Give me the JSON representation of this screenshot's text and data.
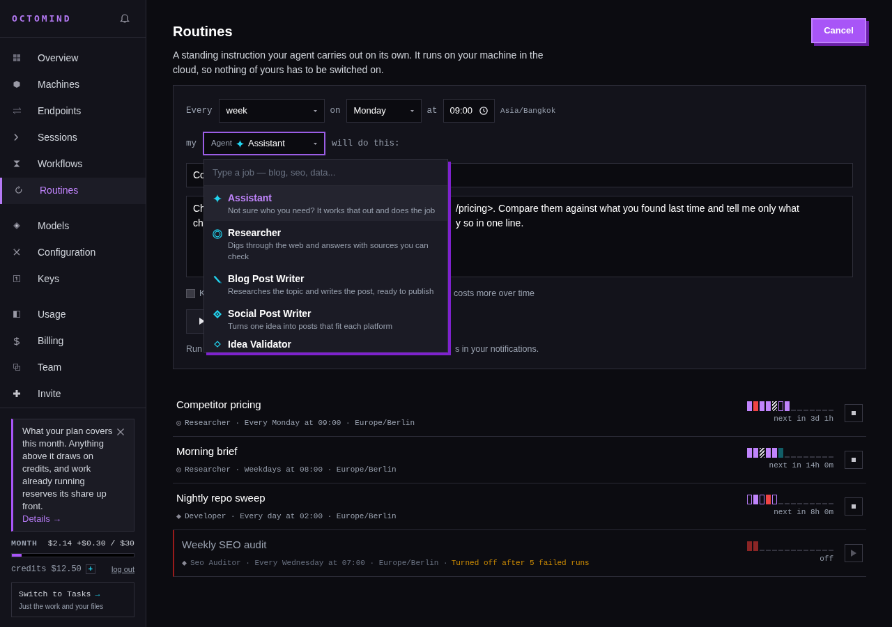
{
  "sidebar": {
    "logo": "OCTOMIND",
    "nav_groups": [
      [
        {
          "label": "Overview",
          "selected": false
        },
        {
          "label": "Machines",
          "selected": false
        },
        {
          "label": "Endpoints",
          "selected": false
        },
        {
          "label": "Sessions",
          "selected": false
        },
        {
          "label": "Workflows",
          "selected": false
        },
        {
          "label": "Routines",
          "selected": true
        }
      ],
      [
        {
          "label": "Models",
          "selected": false
        },
        {
          "label": "Configuration",
          "selected": false
        },
        {
          "label": "Keys",
          "selected": false
        }
      ],
      [
        {
          "label": "Usage",
          "selected": false
        },
        {
          "label": "Billing",
          "selected": false
        },
        {
          "label": "Team",
          "selected": false
        },
        {
          "label": "Invite",
          "selected": false
        }
      ]
    ],
    "notice": {
      "text": "What your plan covers this month. Anything above it draws on credits, and work already running reserves its share up front.",
      "link": "Details →"
    },
    "budget": {
      "label": "MONTH",
      "amount": "$2.14 +$0.30 / $30",
      "level": 0.08
    },
    "credits": "credits $12.50",
    "add_credits": "+",
    "logout": "log out",
    "switch": {
      "title": "Switch to Tasks",
      "arrow": "→",
      "subtitle": "Just the work and your files"
    }
  },
  "page": {
    "title": "Routines",
    "description": "A standing instruction your agent carries out on its own. It runs on your machine in the cloud, so nothing of yours has to be switched on.",
    "cancel": "Cancel"
  },
  "form": {
    "every_label": "Every",
    "frequency": "week",
    "on_label": "on",
    "day": "Monday",
    "at_label": "at",
    "time": "09:00",
    "timezone": "Asia/Bangkok",
    "my_label": "my",
    "agent_prefix": "Agent",
    "agent": "Assistant",
    "suffix": "will do this:",
    "title_field": {
      "left": "Co"
    },
    "prompt_lines": [
      {
        "left": "Ch",
        "right": "/pricing>. Compare them against what you found last time and tell me only what"
      },
      {
        "left": "ch",
        "right": "y so in one line."
      }
    ],
    "checkbox": {
      "checked": false,
      "left": "K",
      "right": "costs more over time"
    },
    "note": {
      "left": "Run",
      "right": "s in your notifications."
    }
  },
  "agent_menu": {
    "placeholder": "Type a job — blog, seo, data...",
    "items": [
      {
        "name": "Assistant",
        "description": "Not sure who you need? It works that out and does the job",
        "selected": true
      },
      {
        "name": "Researcher",
        "description": "Digs through the web and answers with sources you can check",
        "selected": false
      },
      {
        "name": "Blog Post Writer",
        "description": "Researches the topic and writes the post, ready to publish",
        "selected": false
      },
      {
        "name": "Social Post Writer",
        "description": "Turns one idea into posts that fit each platform",
        "selected": false
      },
      {
        "name": "Idea Validator",
        "selected": false
      }
    ]
  },
  "routines": [
    {
      "name": "Competitor pricing",
      "meta": "Researcher · Every Monday at 09:00 · Europe/Berlin",
      "enabled": true,
      "runs": [
        {
          "kind": "ok"
        },
        {
          "kind": "failed"
        },
        {
          "kind": "ok"
        },
        {
          "kind": "ok"
        },
        {
          "kind": "running"
        },
        {
          "kind": "queued"
        },
        {
          "kind": "ok"
        }
      ],
      "next": "next in 3d 1h"
    },
    {
      "name": "Morning brief",
      "meta": "Researcher · Weekdays at 08:00 · Europe/Berlin",
      "enabled": true,
      "runs": [
        {
          "kind": "ok"
        },
        {
          "kind": "ok"
        },
        {
          "kind": "running"
        },
        {
          "kind": "ok"
        },
        {
          "kind": "ok"
        },
        {
          "kind": "skipped"
        }
      ],
      "next": "next in 14h 0m"
    },
    {
      "name": "Nightly repo sweep",
      "meta": "Developer · Every day at 02:00 · Europe/Berlin",
      "enabled": true,
      "runs": [
        {
          "kind": "queued"
        },
        {
          "kind": "ok"
        },
        {
          "kind": "queued"
        },
        {
          "kind": "failed"
        },
        {
          "kind": "queued"
        }
      ],
      "next": "next in 8h 0m"
    },
    {
      "name": "Weekly SEO audit",
      "meta": "Seo Auditor · Every Wednesday at 07:00 · Europe/Berlin ·",
      "warning": "Turned off after 5 failed runs",
      "enabled": false,
      "runs": [
        {
          "kind": "failed"
        },
        {
          "kind": "failed"
        }
      ],
      "next": "off"
    }
  ]
}
